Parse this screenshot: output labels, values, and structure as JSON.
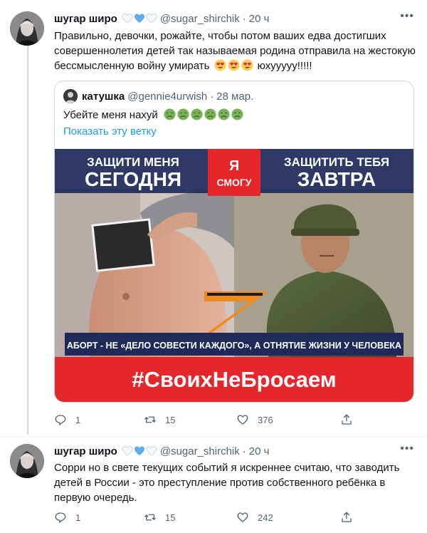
{
  "tweets": [
    {
      "author": "шугар широ",
      "handle": "@sugar_shirchik",
      "time": "20 ч",
      "text_lines": [
        "Правильно, девочки, рожайте, чтобы потом ваших едва достигших",
        "совершеннолетия детей так называемая родина отправила на жестокую",
        "бессмысленную войну умирать",
        "юхууууу!!!!!"
      ],
      "quote": {
        "author": "катушка",
        "handle": "@gennie4urwish",
        "time": "28 мар.",
        "text": "Убейте меня нахуй",
        "show_thread": "Показать эту ветку",
        "image": {
          "top_left": "ЗАЩИТИ МЕНЯ",
          "top_left_big": "СЕГОДНЯ",
          "middle_1": "Я",
          "middle_2": "СМОГУ",
          "top_right": "ЗАЩИТИТЬ ТЕБЯ",
          "top_right_big": "ЗАВТРА",
          "banner": "АБОРТ - НЕ «ДЕЛО СОВЕСТИ КАЖДОГО», А ОТНЯТИЕ ЖИЗНИ У ЧЕЛОВЕКА",
          "hashtag": "#СвоихНеБросаем"
        }
      },
      "replies": "1",
      "retweets": "15",
      "likes": "376"
    },
    {
      "author": "шугар широ",
      "handle": "@sugar_shirchik",
      "time": "20 ч",
      "text_lines": [
        "Сорри но в свете текущих событий я искреннее считаю, что заводить",
        "детей в России - это преступление против собственного ребёнка в",
        "первую очередь."
      ],
      "replies": "1",
      "retweets": "15",
      "likes": "242"
    }
  ],
  "colors": {
    "text": "#0f1419",
    "secondary": "#536471",
    "link": "#1d9bf0",
    "border": "#cfd9de",
    "poster_red": "#e5262b",
    "poster_navy": "#1f2a5a"
  },
  "icons": [
    "white-heart-icon",
    "blue-heart-icon",
    "more-icon",
    "heart-eyes-emoji",
    "nauseated-face-emoji",
    "reply-icon",
    "retweet-icon",
    "like-icon",
    "share-icon"
  ]
}
